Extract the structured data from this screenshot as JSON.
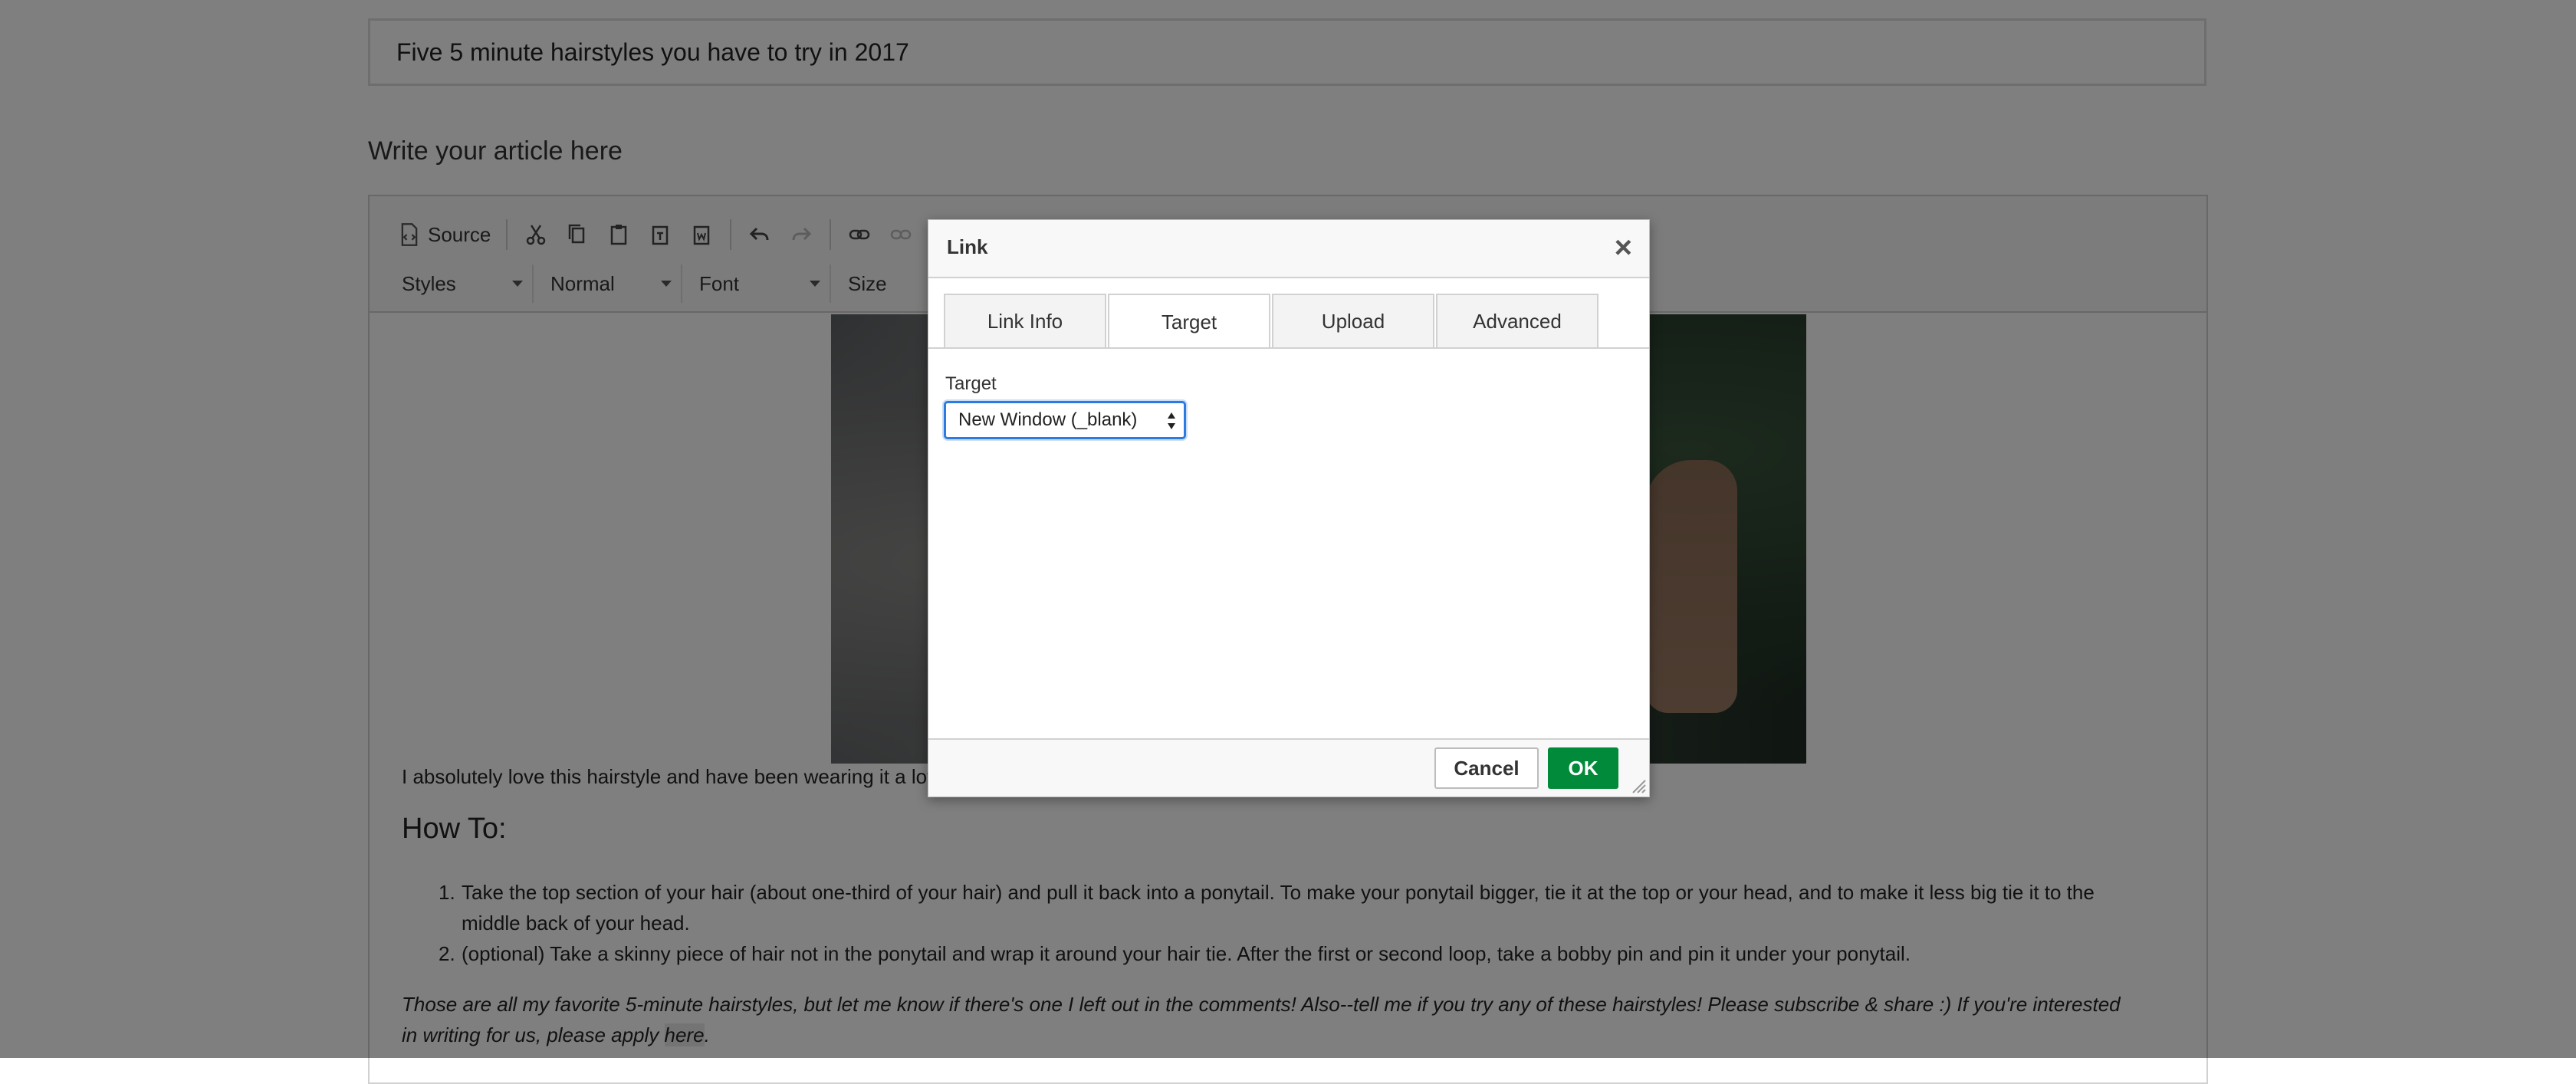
{
  "article": {
    "title": "Five 5 minute hairstyles you have to try in 2017",
    "editor_label": "Write your article here"
  },
  "toolbar": {
    "source_label": "Source",
    "styles_label": "Styles",
    "format_label": "Normal",
    "font_label": "Font",
    "size_label": "Size"
  },
  "content": {
    "para1": "I absolutely love this hairstyle and have been wearing it a lot",
    "heading": "How To:",
    "steps": [
      {
        "num": "1.",
        "text": "Take the top section of your hair (about one-third of your hair) and pull it back into a ponytail. To make your ponytail bigger, tie it at the top or your head, and to make it less big tie it to the middle back of your head."
      },
      {
        "num": "2.",
        "text": "(optional) Take a skinny piece of hair not in the ponytail and wrap it around your hair tie. After the first or second loop, take a bobby pin and pin it under your ponytail."
      }
    ],
    "closing_text": "Those are all my favorite 5-minute hairstyles, but let me know if there's one I left out in the comments! Also--tell me if you try any of these hairstyles! Please subscribe & share :) If you're interested in writing for us, please apply ",
    "closing_link": "here",
    "closing_end": "."
  },
  "dialog": {
    "title": "Link",
    "close_icon": "close-icon",
    "tabs": [
      {
        "label": "Link Info",
        "active": false
      },
      {
        "label": "Target",
        "active": true
      },
      {
        "label": "Upload",
        "active": false
      },
      {
        "label": "Advanced",
        "active": false
      }
    ],
    "target_label": "Target",
    "target_value": "New Window (_blank)",
    "cancel_label": "Cancel",
    "ok_label": "OK"
  },
  "colors": {
    "ok_green": "#008a3a",
    "focus_blue": "#2d7be0",
    "overlay": "rgba(0,0,0,0.5)"
  }
}
